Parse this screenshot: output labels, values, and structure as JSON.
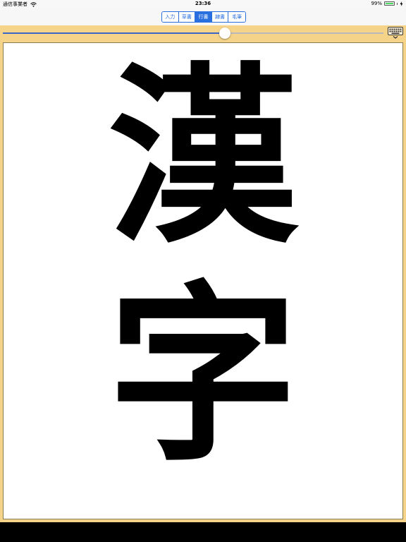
{
  "status_bar": {
    "carrier": "通信事業者",
    "time": "23:36",
    "battery_percent": "99%",
    "battery_level": 0.99
  },
  "segments": [
    {
      "label": "入力",
      "selected": false
    },
    {
      "label": "草書",
      "selected": false
    },
    {
      "label": "行書",
      "selected": true
    },
    {
      "label": "隷書",
      "selected": false
    },
    {
      "label": "毛筆",
      "selected": false
    }
  ],
  "slider": {
    "value": 0.56
  },
  "canvas": {
    "characters": [
      "漢",
      "字"
    ]
  },
  "icons": {
    "wifi": "wifi-icon",
    "battery": "battery-icon",
    "charging": "charging-icon",
    "keyboard": "keyboard-icon",
    "chevron": "chevron-down-icon"
  },
  "colors": {
    "accent": "#2a6fe0",
    "toolbar": "#f5d48a",
    "battery": "#4cd964"
  }
}
